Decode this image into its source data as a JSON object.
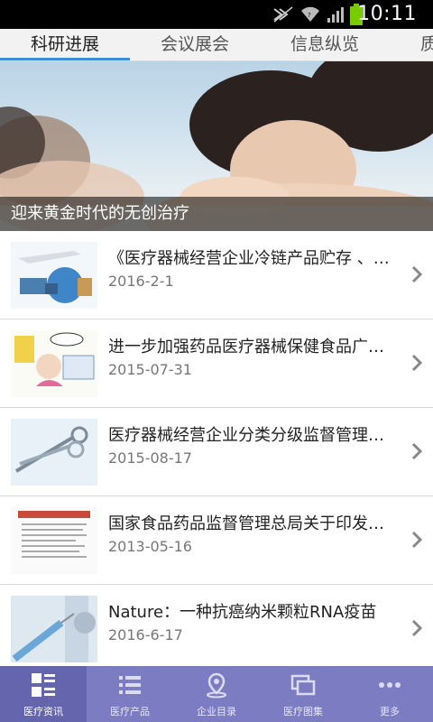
{
  "status_bar": {
    "time": "10:11"
  },
  "tabs": [
    {
      "label": "科研进展",
      "active": true
    },
    {
      "label": "会议展会",
      "active": false
    },
    {
      "label": "信息纵览",
      "active": false
    },
    {
      "label": "质",
      "active": false
    }
  ],
  "banner": {
    "caption": "迎来黄金时代的无创治疗"
  },
  "news": [
    {
      "title": "《医疗器械经营企业冷链产品贮存 、…",
      "date": "2016-2-1",
      "thumb_icon": "logistics-thumb"
    },
    {
      "title": "进一步加强药品医疗器械保健食品广…",
      "date": "2015-07-31",
      "thumb_icon": "cartoon-thumb"
    },
    {
      "title": "医疗器械经营企业分类分级监督管理…",
      "date": "2015-08-17",
      "thumb_icon": "scissors-thumb"
    },
    {
      "title": "国家食品药品监督管理总局关于印发…",
      "date": "2013-05-16",
      "thumb_icon": "document-thumb"
    },
    {
      "title": "Nature：一种抗癌纳米颗粒RNA疫苗",
      "date": "2016-6-17",
      "thumb_icon": "syringe-thumb"
    }
  ],
  "bottom_nav": [
    {
      "label": "医疗资讯",
      "icon": "grid-list-icon",
      "active": true
    },
    {
      "label": "医疗产品",
      "icon": "list-icon",
      "active": false
    },
    {
      "label": "企业目录",
      "icon": "location-pin-icon",
      "active": false
    },
    {
      "label": "医疗图集",
      "icon": "gallery-icon",
      "active": false
    },
    {
      "label": "更多",
      "icon": "more-icon",
      "active": false
    }
  ],
  "colors": {
    "tab_indicator": "#3f8fd8",
    "bottom_nav_bg": "#7b7cc1",
    "bottom_nav_active": "#6565ad"
  }
}
